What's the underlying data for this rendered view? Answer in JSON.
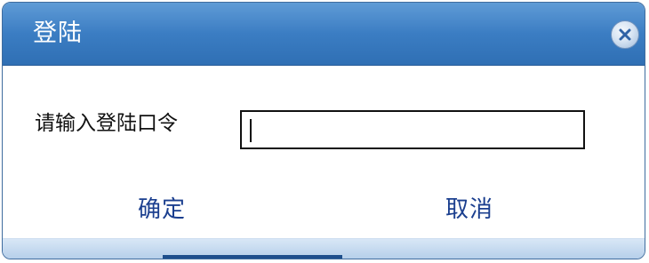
{
  "dialog": {
    "title": "登陆",
    "close_icon": "close-x-icon",
    "prompt_label": "请输入登陆口令",
    "password_value": "",
    "ok_label": "确定",
    "cancel_label": "取消"
  },
  "colors": {
    "titlebar": "#3b7dc3",
    "button_text": "#1b3f8f",
    "footer": "#c8dcf0"
  }
}
